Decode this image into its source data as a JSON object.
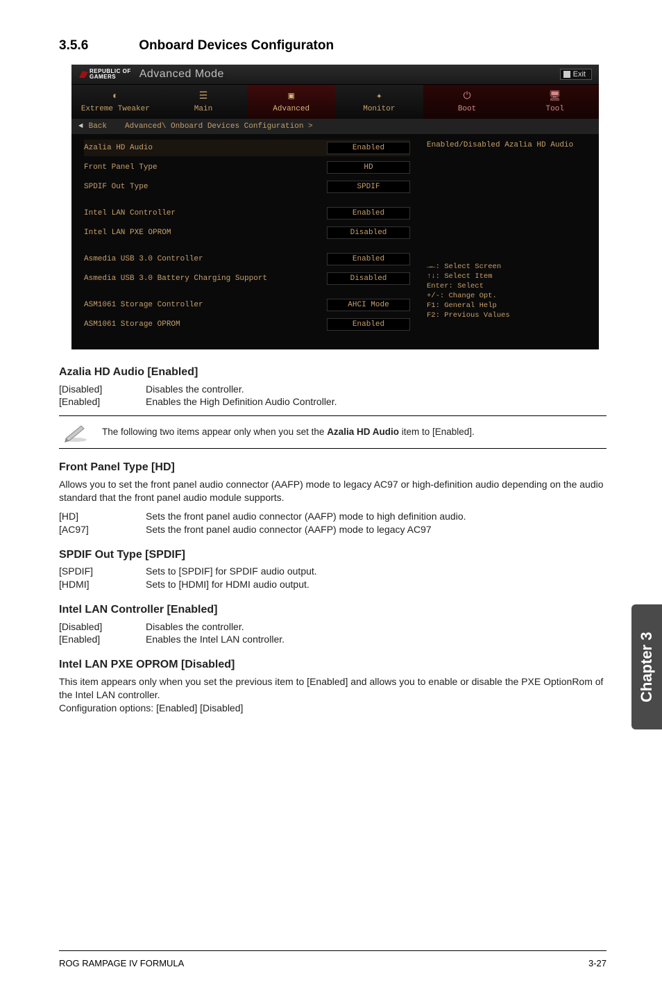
{
  "section": {
    "number": "3.5.6",
    "title": "Onboard Devices Configuraton"
  },
  "bios": {
    "logo_line1": "REPUBLIC OF",
    "logo_line2": "GAMERS",
    "mode": "Advanced Mode",
    "exit": "Exit",
    "tabs": {
      "t1": "Extreme Tweaker",
      "t2": "Main",
      "t3": "Advanced",
      "t4": "Monitor",
      "t5": "Boot",
      "t6": "Tool"
    },
    "back": "Back",
    "breadcrumb": "Advanced\\ Onboard Devices Configuration >",
    "rows": [
      {
        "label": "Azalia HD Audio",
        "value": "Enabled"
      },
      {
        "label": "Front Panel Type",
        "value": "HD"
      },
      {
        "label": "SPDIF Out Type",
        "value": "SPDIF"
      }
    ],
    "rows2": [
      {
        "label": "Intel LAN Controller",
        "value": "Enabled"
      },
      {
        "label": "Intel LAN PXE OPROM",
        "value": "Disabled"
      }
    ],
    "rows3": [
      {
        "label": "Asmedia USB 3.0 Controller",
        "value": "Enabled"
      },
      {
        "label": "Asmedia USB 3.0 Battery Charging Support",
        "value": "Disabled"
      }
    ],
    "rows4": [
      {
        "label": "ASM1061 Storage Controller",
        "value": "AHCI Mode"
      },
      {
        "label": "ASM1061 Storage OPROM",
        "value": "Enabled"
      }
    ],
    "help": "Enabled/Disabled Azalia HD Audio",
    "nav": {
      "l1": "→←: Select Screen",
      "l2": "↑↓: Select Item",
      "l3": "Enter: Select",
      "l4": "+/-: Change Opt.",
      "l5": "F1: General Help",
      "l6": "F2: Previous Values"
    }
  },
  "doc": {
    "azalia_heading": "Azalia HD Audio [Enabled]",
    "azalia_opts": [
      {
        "key": "[Disabled]",
        "val": "Disables the controller."
      },
      {
        "key": "[Enabled]",
        "val": "Enables the High Definition Audio Controller."
      }
    ],
    "note_prefix": "The following two items appear only when you set the ",
    "note_bold": "Azalia HD Audio",
    "note_suffix": " item to [Enabled].",
    "fpt_heading": "Front Panel Type [HD]",
    "fpt_body": "Allows you to set the front panel audio connector (AAFP) mode to legacy AC97 or high-definition audio depending on the audio standard that the front panel audio module supports.",
    "fpt_opts": [
      {
        "key": "[HD]",
        "val": "Sets the front panel audio connector (AAFP) mode to high definition audio."
      },
      {
        "key": "[AC97]",
        "val": "Sets the front panel audio connector (AAFP) mode to legacy AC97"
      }
    ],
    "spdif_heading": "SPDIF Out Type [SPDIF]",
    "spdif_opts": [
      {
        "key": "[SPDIF]",
        "val": "Sets to [SPDIF] for SPDIF audio output."
      },
      {
        "key": "[HDMI]",
        "val": "Sets to [HDMI] for HDMI audio output."
      }
    ],
    "lan_heading": "Intel LAN Controller [Enabled]",
    "lan_opts": [
      {
        "key": "[Disabled]",
        "val": "Disables the controller."
      },
      {
        "key": "[Enabled]",
        "val": "Enables the Intel LAN controller."
      }
    ],
    "pxe_heading": "Intel LAN PXE OPROM [Disabled]",
    "pxe_body": "This item appears only when you set the previous item to [Enabled] and allows you to enable or disable the PXE OptionRom of the Intel LAN controller.\nConfiguration options: [Enabled] [Disabled]"
  },
  "side_tab": "Chapter 3",
  "footer": {
    "left": "ROG RAMPAGE IV FORMULA",
    "right": "3-27"
  }
}
